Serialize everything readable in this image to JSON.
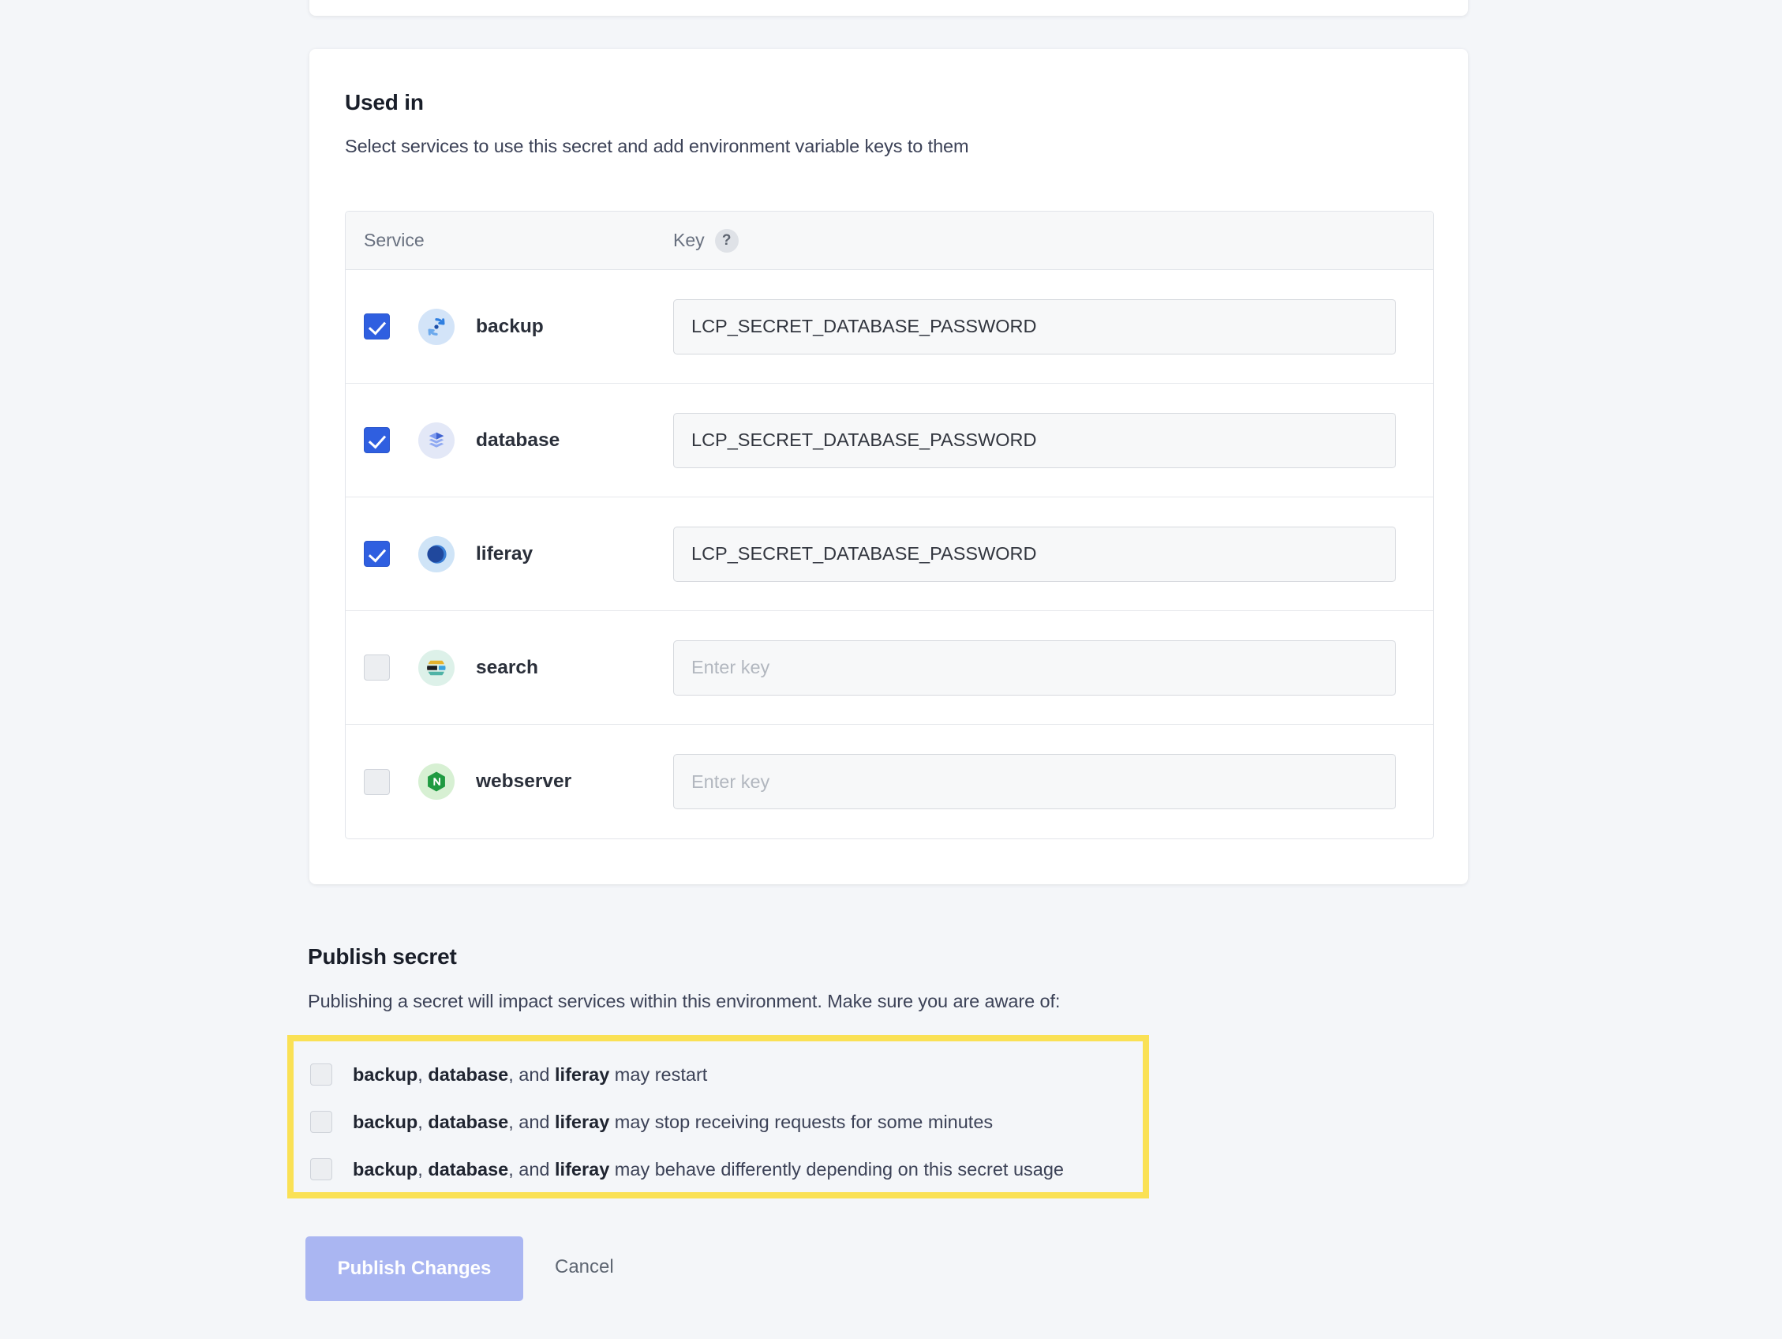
{
  "card": {
    "title": "Used in",
    "subtitle": "Select services to use this secret and add environment variable keys to them",
    "table": {
      "columns": {
        "service": "Service",
        "key": "Key",
        "key_help_glyph": "?"
      },
      "key_placeholder": "Enter key",
      "rows": [
        {
          "name": "backup",
          "icon": "backup-sync-icon",
          "checked": true,
          "key": "LCP_SECRET_DATABASE_PASSWORD"
        },
        {
          "name": "database",
          "icon": "database-layers-icon",
          "checked": true,
          "key": "LCP_SECRET_DATABASE_PASSWORD"
        },
        {
          "name": "liferay",
          "icon": "liferay-icon",
          "checked": true,
          "key": "LCP_SECRET_DATABASE_PASSWORD"
        },
        {
          "name": "search",
          "icon": "elasticsearch-icon",
          "checked": false,
          "key": ""
        },
        {
          "name": "webserver",
          "icon": "nginx-icon",
          "checked": false,
          "key": ""
        }
      ]
    }
  },
  "publish": {
    "title": "Publish secret",
    "subtitle": "Publishing a secret will impact services within this environment. Make sure you are aware of:",
    "warnings": [
      {
        "services": [
          "backup",
          "database",
          "liferay"
        ],
        "suffix": "may restart",
        "checked": false
      },
      {
        "services": [
          "backup",
          "database",
          "liferay"
        ],
        "suffix": "may stop receiving requests for some minutes",
        "checked": false
      },
      {
        "services": [
          "backup",
          "database",
          "liferay"
        ],
        "suffix": "may behave differently depending on this secret usage",
        "checked": false
      }
    ],
    "publish_button": "Publish Changes",
    "cancel_button": "Cancel"
  },
  "colors": {
    "highlight_border": "#fae155",
    "checkbox_on": "#2f5fe0",
    "publish_button_disabled": "#aab6f2",
    "page_bg": "#f4f6f9"
  }
}
